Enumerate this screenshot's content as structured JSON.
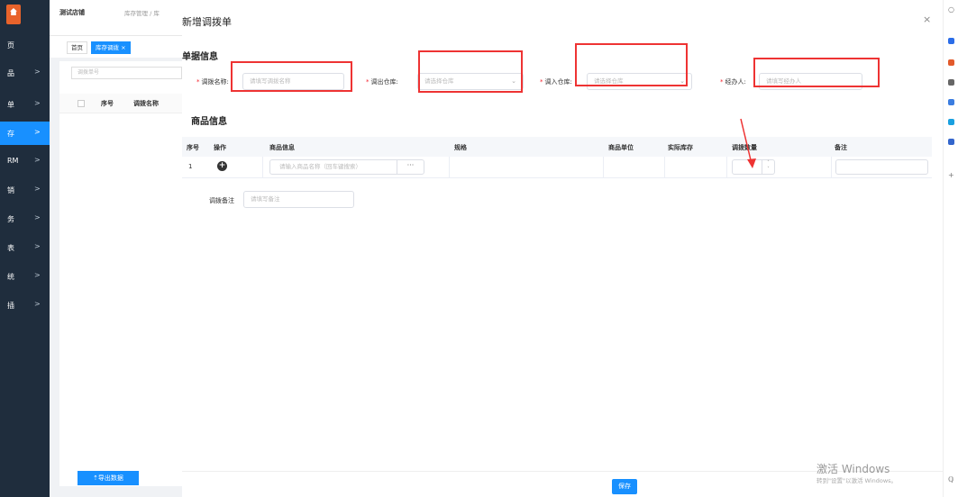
{
  "sidebar": {
    "items": [
      {
        "label": "页",
        "has_arrow": false
      },
      {
        "label": "品",
        "has_arrow": true
      },
      {
        "label": "单",
        "has_arrow": true
      },
      {
        "label": "存",
        "has_arrow": true
      },
      {
        "label": "RM",
        "has_arrow": true
      },
      {
        "label": "销",
        "has_arrow": true
      },
      {
        "label": "务",
        "has_arrow": true
      },
      {
        "label": "表",
        "has_arrow": true
      },
      {
        "label": "统",
        "has_arrow": true
      },
      {
        "label": "插",
        "has_arrow": true
      }
    ],
    "arrow_glyph": ">"
  },
  "background": {
    "store_name": "测试店铺",
    "breadcrumb": "库存管理 / 库",
    "tabs": [
      {
        "label": "首页"
      },
      {
        "label": "库存调拨 ×"
      }
    ],
    "search_placeholder": "调拨单号",
    "columns": [
      "序号",
      "调拨名称"
    ],
    "export_label": "⇡导出数据"
  },
  "modal": {
    "title": "新增调拨单",
    "close_glyph": "×",
    "section_info": "单据信息",
    "fields": {
      "name_label": "调拨名称:",
      "name_placeholder": "请填写调拨名称",
      "out_label": "调出仓库:",
      "out_placeholder": "请选择仓库",
      "in_label": "调入仓库:",
      "in_placeholder": "请选择仓库",
      "handler_label": "经办人:",
      "handler_placeholder": "请填写经办人",
      "req_mark": "*",
      "dropdown_glyph": "⌄"
    },
    "section_goods": "商品信息",
    "table": {
      "headers": [
        "序号",
        "操作",
        "商品信息",
        "规格",
        "商品单位",
        "实际库存",
        "调拨数量",
        "备注"
      ],
      "row": {
        "index": "1",
        "add_glyph": "+",
        "product_placeholder": "请输入商品名称（回车键搜索）",
        "dots": "···",
        "spin_up": "˄",
        "spin_down": "˅"
      }
    },
    "remark_label": "调拨备注",
    "remark_placeholder": "请填写备注",
    "save_label": "保存"
  },
  "watermark": {
    "line1": "激活 Windows",
    "line2": "转到\"设置\"以激活 Windows。"
  },
  "right_strip": {
    "top_glyph": "○",
    "plus_glyph": "+",
    "bottom_glyph": "ℚ"
  },
  "colors": {
    "sidebar_bg": "#1f2d3d",
    "accent": "#1890ff",
    "annotation_red": "#ee3333"
  }
}
